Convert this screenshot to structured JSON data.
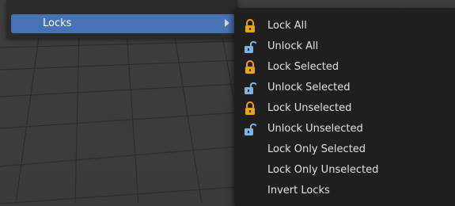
{
  "parent_menu": {
    "item_label": "Locks"
  },
  "submenu": {
    "items": [
      {
        "label": "Lock All",
        "icon": "lock-closed-icon"
      },
      {
        "label": "Unlock All",
        "icon": "lock-open-icon"
      },
      {
        "label": "Lock Selected",
        "icon": "lock-closed-icon"
      },
      {
        "label": "Unlock Selected",
        "icon": "lock-open-icon"
      },
      {
        "label": "Lock Unselected",
        "icon": "lock-closed-icon"
      },
      {
        "label": "Unlock Unselected",
        "icon": "lock-open-icon"
      },
      {
        "label": "Lock Only Selected",
        "icon": ""
      },
      {
        "label": "Lock Only Unselected",
        "icon": ""
      },
      {
        "label": "Invert Locks",
        "icon": ""
      }
    ]
  },
  "colors": {
    "highlight": "#4772b3",
    "menu_bg": "#1f1f1f",
    "lock_closed": "#e8a21a",
    "lock_open": "#7fb3e6"
  }
}
